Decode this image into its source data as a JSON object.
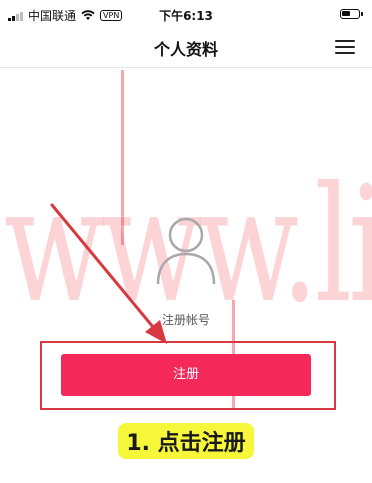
{
  "status_bar": {
    "carrier": "中国联通",
    "vpn": "VPN",
    "time": "下午6:13"
  },
  "nav": {
    "title": "个人资料",
    "menu_icon": "hamburger-menu-icon"
  },
  "watermark": {
    "text": "www.lian.com"
  },
  "profile": {
    "avatar_icon": "user-avatar-icon",
    "register_account_label": "注册帐号",
    "register_button_label": "注册"
  },
  "annotation": {
    "step_caption": "1. 点击注册",
    "arrow_color": "#d8383f",
    "highlight_color": "#f6f63a"
  },
  "colors": {
    "primary_button": "#f5285a",
    "highlight_box": "#d8383f"
  }
}
